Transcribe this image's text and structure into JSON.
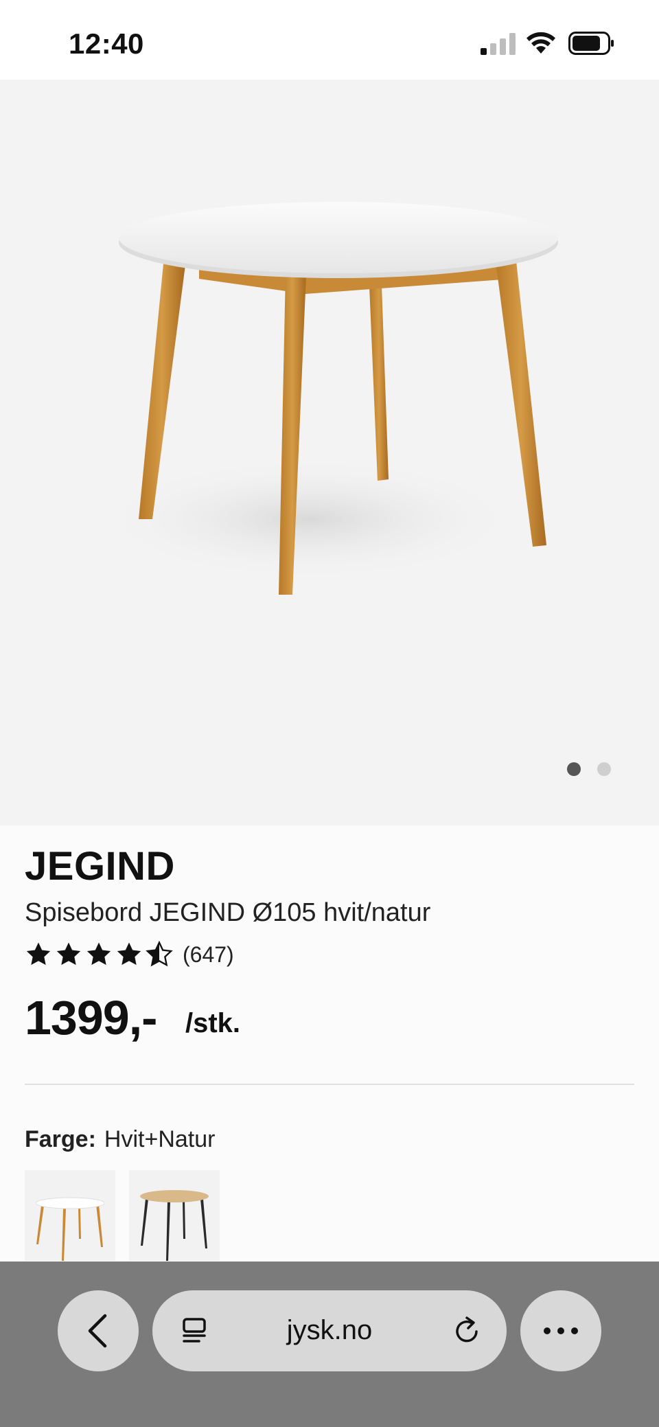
{
  "status_bar": {
    "time": "12:40"
  },
  "gallery": {
    "image_count": 2,
    "active_index": 0
  },
  "product": {
    "brand": "JEGIND",
    "name": "Spisebord JEGIND Ø105 hvit/natur",
    "rating": 4.5,
    "rating_count": "(647)",
    "price": "1399,-",
    "unit": "/stk."
  },
  "color": {
    "label": "Farge:",
    "value": "Hvit+Natur",
    "options": [
      "white-top-natural-legs",
      "natural-top-black-legs"
    ]
  },
  "browser": {
    "url": "jysk.no",
    "back_icon": "chevron-left-icon",
    "reader_icon": "reader-mode-icon",
    "reload_icon": "reload-icon",
    "more_icon": "more-icon"
  }
}
